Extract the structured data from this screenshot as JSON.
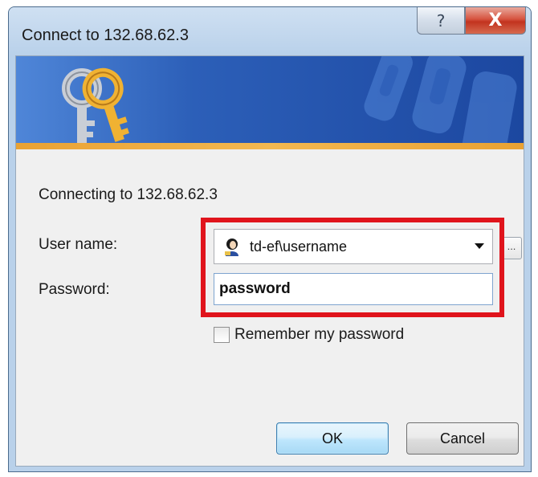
{
  "window": {
    "title": "Connect to 132.68.62.3",
    "help_glyph": "?",
    "close_glyph": "X"
  },
  "dialog": {
    "connecting_text": "Connecting to 132.68.62.3",
    "user_label": "User name:",
    "user_value": "td-ef\\username",
    "browse_label": "...",
    "password_label": "Password:",
    "password_value": "password",
    "remember_label": "Remember my password",
    "remember_checked": false
  },
  "buttons": {
    "ok": "OK",
    "cancel": "Cancel"
  },
  "icons": {
    "banner": "keys-icon",
    "user": "user-account-icon",
    "dropdown": "chevron-down-icon"
  },
  "colors": {
    "highlight": "#e0141c",
    "banner": "#2c5fb8",
    "banner_stripe": "#e9a233"
  }
}
